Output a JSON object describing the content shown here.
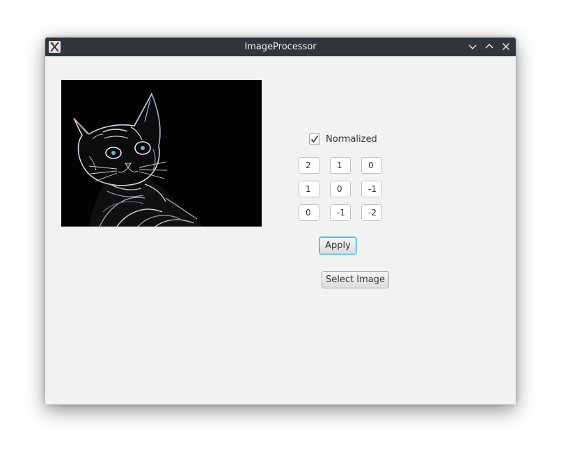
{
  "window": {
    "title": "ImageProcessor",
    "icons": {
      "app": "x-app-icon",
      "minimize": "chevron-down-icon",
      "maximize": "chevron-up-icon",
      "close": "close-icon"
    },
    "titlebar_color": "#31363b"
  },
  "image": {
    "description_icon": "kitten-photo"
  },
  "controls": {
    "normalized": {
      "label": "Normalized",
      "checked": true
    },
    "kernel": [
      [
        "2",
        "1",
        "0"
      ],
      [
        "1",
        "0",
        "-1"
      ],
      [
        "0",
        "-1",
        "-2"
      ]
    ],
    "apply_label": "Apply",
    "select_label": "Select Image"
  },
  "colors": {
    "focus": "#3daee9",
    "window_bg": "#f2f2f2"
  }
}
